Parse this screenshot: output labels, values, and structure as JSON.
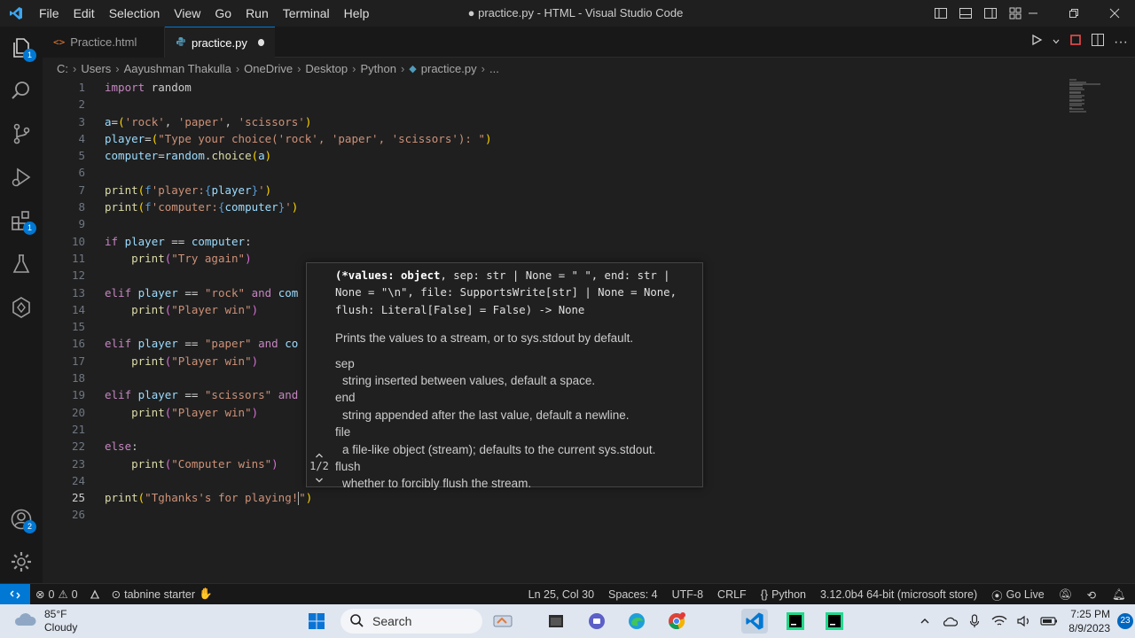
{
  "window": {
    "title": "● practice.py - HTML - Visual Studio Code"
  },
  "menu": [
    "File",
    "Edit",
    "Selection",
    "View",
    "Go",
    "Run",
    "Terminal",
    "Help"
  ],
  "activity_badges": {
    "explorer": "1",
    "extensions": "1",
    "accounts": "2"
  },
  "tabs": [
    {
      "label": "Practice.html",
      "icon": "html-file-icon"
    },
    {
      "label": "practice.py",
      "icon": "python-file-icon",
      "modified": true
    }
  ],
  "breadcrumb": [
    "C:",
    "Users",
    "Aayushman Thakulla",
    "OneDrive",
    "Desktop",
    "Python",
    "practice.py",
    "..."
  ],
  "editor": {
    "line_numbers": [
      "1",
      "2",
      "3",
      "4",
      "5",
      "6",
      "7",
      "8",
      "9",
      "10",
      "11",
      "12",
      "13",
      "14",
      "15",
      "16",
      "17",
      "18",
      "19",
      "20",
      "21",
      "22",
      "23",
      "24",
      "25",
      "26"
    ],
    "active_line": "25"
  },
  "signature_help": {
    "signature_lines": [
      "(*values: object, sep: str | None = \" \", end: str |",
      "None = \"\\n\", file: SupportsWrite[str] | None = None,",
      "flush: Literal[False] = False) -> None"
    ],
    "summary": "Prints the values to a stream, or to sys.stdout by default.",
    "params": [
      {
        "name": "sep",
        "desc": "string inserted between values, default a space."
      },
      {
        "name": "end",
        "desc": "string appended after the last value, default a newline."
      },
      {
        "name": "file",
        "desc": "a file-like object (stream); defaults to the current sys.stdout."
      },
      {
        "name": "flush",
        "desc": "whether to forcibly flush the stream."
      }
    ],
    "counter": "1/2"
  },
  "statusbar": {
    "errors": "0",
    "warnings": "0",
    "tabnine": "tabnine starter",
    "position": "Ln 25, Col 30",
    "spaces": "Spaces: 4",
    "encoding": "UTF-8",
    "eol": "CRLF",
    "language": "Python",
    "interpreter": "3.12.0b4 64-bit (microsoft store)",
    "golive": "Go Live"
  },
  "taskbar": {
    "weather_temp": "85°F",
    "weather_desc": "Cloudy",
    "search_placeholder": "Search",
    "time": "7:25 PM",
    "date": "8/9/2023",
    "notifications": "23"
  },
  "colors": {
    "accent": "#0078d4",
    "editor_bg": "#1f1f1f",
    "keyword": "#c586c0",
    "string": "#ce9178",
    "variable": "#9cdcfe",
    "function": "#dcdcaa"
  }
}
